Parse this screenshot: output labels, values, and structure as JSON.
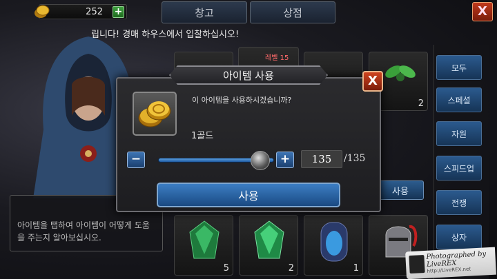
{
  "top_bar": {
    "gold_amount": "252",
    "plus_label": "+",
    "tabs": [
      "창고",
      "상점"
    ],
    "close_label": "X"
  },
  "ticker": "립니다! 경매 하우스에서 입찰하십시오!",
  "grid": {
    "top_counts": [
      "2"
    ],
    "bottom_counts": [
      "5",
      "2",
      "1"
    ],
    "partial_label": "레벨 15"
  },
  "categories": [
    "모두",
    "스페셜",
    "자원",
    "스피드업",
    "전쟁",
    "상자"
  ],
  "use_small_label": "사용",
  "help_text": "아이템을 탭하여 아이템이 어떻게 도움을 주는지 알아보십시오.",
  "modal": {
    "title": "아이템 사용",
    "close_label": "X",
    "question": "이 아이템을 사용하시겠습니까?",
    "item_name": "1골드",
    "minus_label": "−",
    "plus_label": "+",
    "quantity": "135",
    "max_label": "/135",
    "use_label": "사용",
    "slider_fraction": 1.0
  },
  "watermark": {
    "main": "Photographed by LiveREX",
    "sub": "http://LiveREX.net"
  },
  "colors": {
    "accent_blue": "#2b5a8e",
    "close_red": "#c0391c",
    "gold": "#d9a520"
  }
}
